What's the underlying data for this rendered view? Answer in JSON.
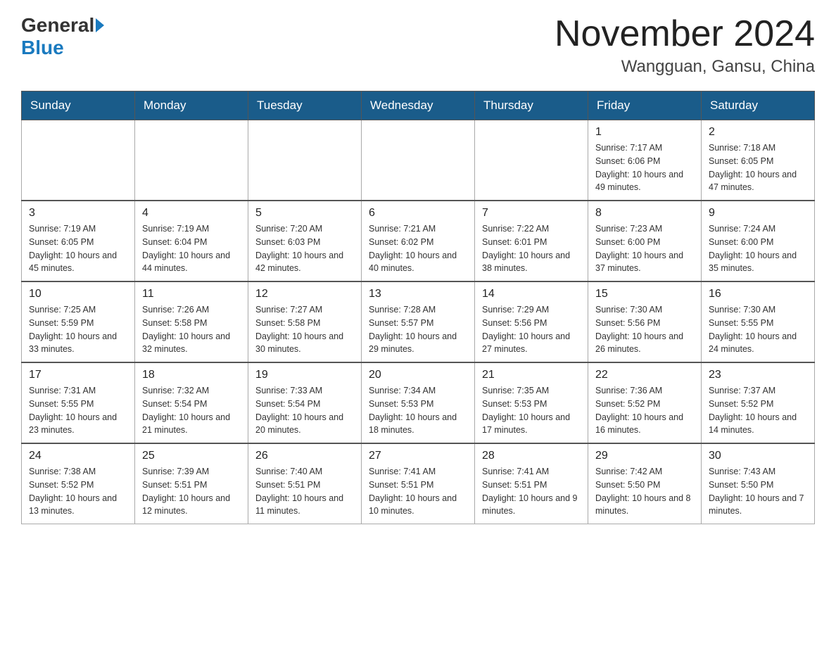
{
  "header": {
    "logo_text_general": "General",
    "logo_text_blue": "Blue",
    "month_title": "November 2024",
    "location": "Wangguan, Gansu, China"
  },
  "weekdays": [
    "Sunday",
    "Monday",
    "Tuesday",
    "Wednesday",
    "Thursday",
    "Friday",
    "Saturday"
  ],
  "weeks": [
    [
      {
        "day": "",
        "info": ""
      },
      {
        "day": "",
        "info": ""
      },
      {
        "day": "",
        "info": ""
      },
      {
        "day": "",
        "info": ""
      },
      {
        "day": "",
        "info": ""
      },
      {
        "day": "1",
        "info": "Sunrise: 7:17 AM\nSunset: 6:06 PM\nDaylight: 10 hours and 49 minutes."
      },
      {
        "day": "2",
        "info": "Sunrise: 7:18 AM\nSunset: 6:05 PM\nDaylight: 10 hours and 47 minutes."
      }
    ],
    [
      {
        "day": "3",
        "info": "Sunrise: 7:19 AM\nSunset: 6:05 PM\nDaylight: 10 hours and 45 minutes."
      },
      {
        "day": "4",
        "info": "Sunrise: 7:19 AM\nSunset: 6:04 PM\nDaylight: 10 hours and 44 minutes."
      },
      {
        "day": "5",
        "info": "Sunrise: 7:20 AM\nSunset: 6:03 PM\nDaylight: 10 hours and 42 minutes."
      },
      {
        "day": "6",
        "info": "Sunrise: 7:21 AM\nSunset: 6:02 PM\nDaylight: 10 hours and 40 minutes."
      },
      {
        "day": "7",
        "info": "Sunrise: 7:22 AM\nSunset: 6:01 PM\nDaylight: 10 hours and 38 minutes."
      },
      {
        "day": "8",
        "info": "Sunrise: 7:23 AM\nSunset: 6:00 PM\nDaylight: 10 hours and 37 minutes."
      },
      {
        "day": "9",
        "info": "Sunrise: 7:24 AM\nSunset: 6:00 PM\nDaylight: 10 hours and 35 minutes."
      }
    ],
    [
      {
        "day": "10",
        "info": "Sunrise: 7:25 AM\nSunset: 5:59 PM\nDaylight: 10 hours and 33 minutes."
      },
      {
        "day": "11",
        "info": "Sunrise: 7:26 AM\nSunset: 5:58 PM\nDaylight: 10 hours and 32 minutes."
      },
      {
        "day": "12",
        "info": "Sunrise: 7:27 AM\nSunset: 5:58 PM\nDaylight: 10 hours and 30 minutes."
      },
      {
        "day": "13",
        "info": "Sunrise: 7:28 AM\nSunset: 5:57 PM\nDaylight: 10 hours and 29 minutes."
      },
      {
        "day": "14",
        "info": "Sunrise: 7:29 AM\nSunset: 5:56 PM\nDaylight: 10 hours and 27 minutes."
      },
      {
        "day": "15",
        "info": "Sunrise: 7:30 AM\nSunset: 5:56 PM\nDaylight: 10 hours and 26 minutes."
      },
      {
        "day": "16",
        "info": "Sunrise: 7:30 AM\nSunset: 5:55 PM\nDaylight: 10 hours and 24 minutes."
      }
    ],
    [
      {
        "day": "17",
        "info": "Sunrise: 7:31 AM\nSunset: 5:55 PM\nDaylight: 10 hours and 23 minutes."
      },
      {
        "day": "18",
        "info": "Sunrise: 7:32 AM\nSunset: 5:54 PM\nDaylight: 10 hours and 21 minutes."
      },
      {
        "day": "19",
        "info": "Sunrise: 7:33 AM\nSunset: 5:54 PM\nDaylight: 10 hours and 20 minutes."
      },
      {
        "day": "20",
        "info": "Sunrise: 7:34 AM\nSunset: 5:53 PM\nDaylight: 10 hours and 18 minutes."
      },
      {
        "day": "21",
        "info": "Sunrise: 7:35 AM\nSunset: 5:53 PM\nDaylight: 10 hours and 17 minutes."
      },
      {
        "day": "22",
        "info": "Sunrise: 7:36 AM\nSunset: 5:52 PM\nDaylight: 10 hours and 16 minutes."
      },
      {
        "day": "23",
        "info": "Sunrise: 7:37 AM\nSunset: 5:52 PM\nDaylight: 10 hours and 14 minutes."
      }
    ],
    [
      {
        "day": "24",
        "info": "Sunrise: 7:38 AM\nSunset: 5:52 PM\nDaylight: 10 hours and 13 minutes."
      },
      {
        "day": "25",
        "info": "Sunrise: 7:39 AM\nSunset: 5:51 PM\nDaylight: 10 hours and 12 minutes."
      },
      {
        "day": "26",
        "info": "Sunrise: 7:40 AM\nSunset: 5:51 PM\nDaylight: 10 hours and 11 minutes."
      },
      {
        "day": "27",
        "info": "Sunrise: 7:41 AM\nSunset: 5:51 PM\nDaylight: 10 hours and 10 minutes."
      },
      {
        "day": "28",
        "info": "Sunrise: 7:41 AM\nSunset: 5:51 PM\nDaylight: 10 hours and 9 minutes."
      },
      {
        "day": "29",
        "info": "Sunrise: 7:42 AM\nSunset: 5:50 PM\nDaylight: 10 hours and 8 minutes."
      },
      {
        "day": "30",
        "info": "Sunrise: 7:43 AM\nSunset: 5:50 PM\nDaylight: 10 hours and 7 minutes."
      }
    ]
  ]
}
